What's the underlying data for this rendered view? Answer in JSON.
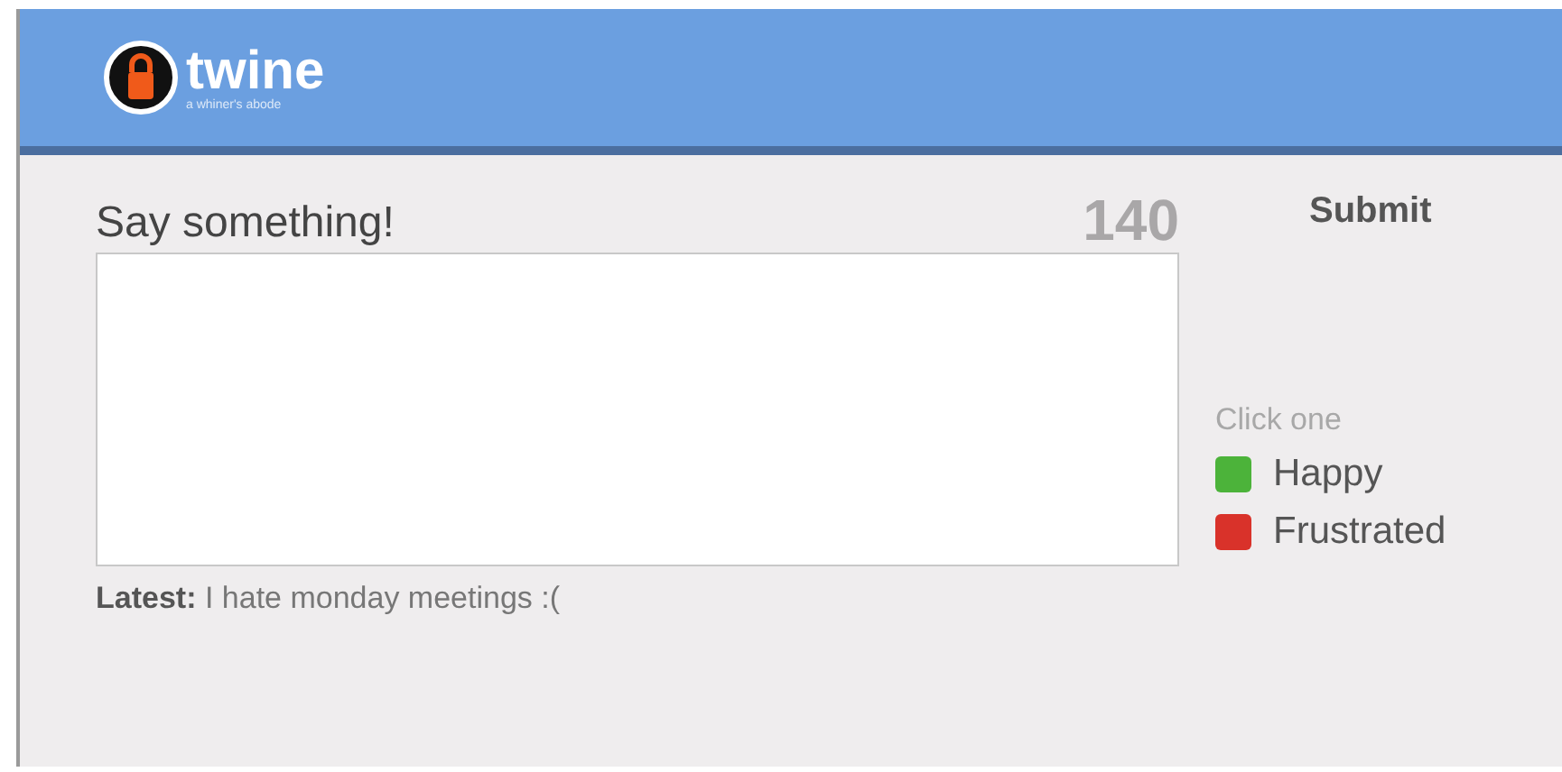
{
  "header": {
    "logo": "twine",
    "tagline": "a whiner's abode"
  },
  "compose": {
    "prompt": "Say something!",
    "counter": "140",
    "submit": "Submit"
  },
  "latest": "**Latest:** I hate monday meetings :(",
  "moods": {
    "label": "Click one",
    "options": [
      {
        "label": "Happy",
        "color": "#4cb33a"
      },
      {
        "label": "Frustrated",
        "color": "#d9322a"
      }
    ]
  }
}
